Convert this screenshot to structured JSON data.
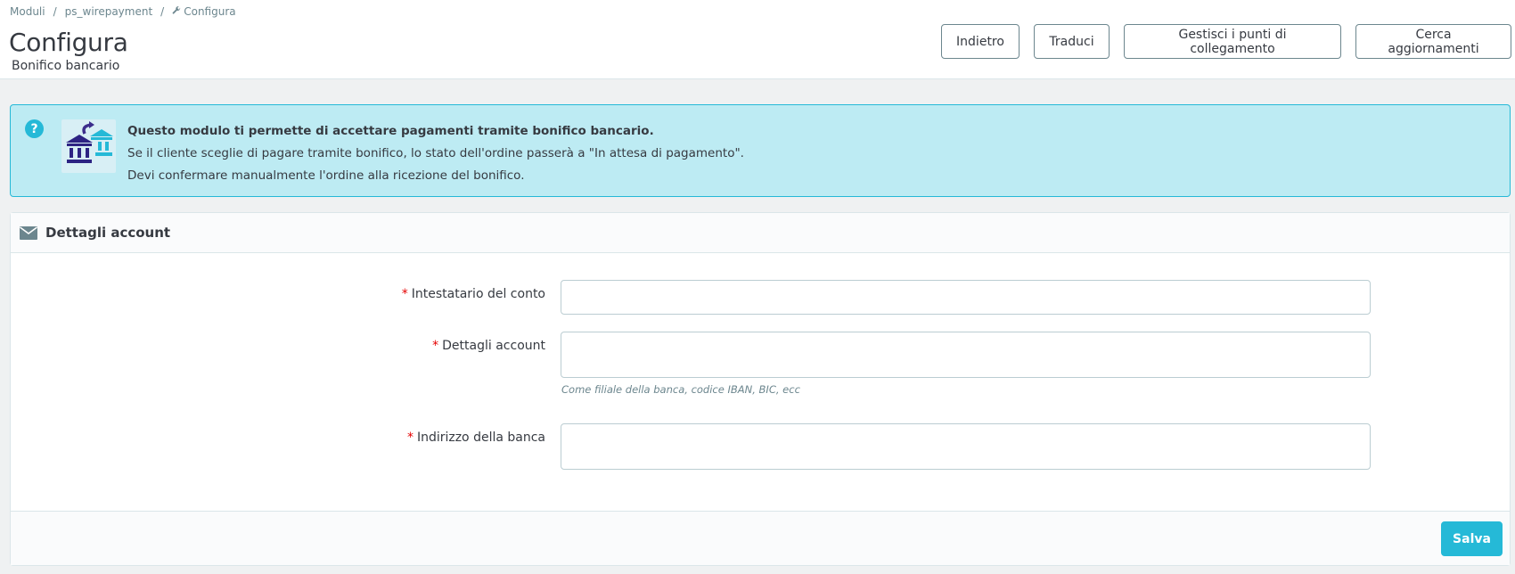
{
  "breadcrumb": {
    "items": [
      "Moduli",
      "ps_wirepayment",
      "Configura"
    ],
    "separator": "/"
  },
  "header": {
    "title": "Configura",
    "subtitle": "Bonifico bancario"
  },
  "toolbar": {
    "back_label": "Indietro",
    "translate_label": "Traduci",
    "hooks_label": "Gestisci i punti di collegamento",
    "updates_label": "Cerca aggiornamenti"
  },
  "alert": {
    "icon": "question-circle-icon",
    "title": "Questo modulo ti permette di accettare pagamenti tramite bonifico bancario.",
    "line1": "Se il cliente sceglie di pagare tramite bonifico, lo stato dell'ordine passerà a \"In attesa di pagamento\".",
    "line2": "Devi confermare manualmente l'ordine alla ricezione del bonifico."
  },
  "panel": {
    "icon": "envelope-icon",
    "heading": "Dettagli account",
    "fields": [
      {
        "required_mark": "*",
        "label": "Intestatario del conto",
        "value": ""
      },
      {
        "required_mark": "*",
        "label": "Dettagli account",
        "value": "",
        "help": "Come filiale della banca, codice IBAN, BIC, ecc"
      },
      {
        "required_mark": "*",
        "label": "Indirizzo della banca",
        "value": ""
      }
    ],
    "save_label": "Salva"
  },
  "colors": {
    "primary": "#25b9d7",
    "alert_bg": "#bdebf3",
    "required": "#e50000",
    "text": "#363a41",
    "muted": "#6c868e"
  }
}
